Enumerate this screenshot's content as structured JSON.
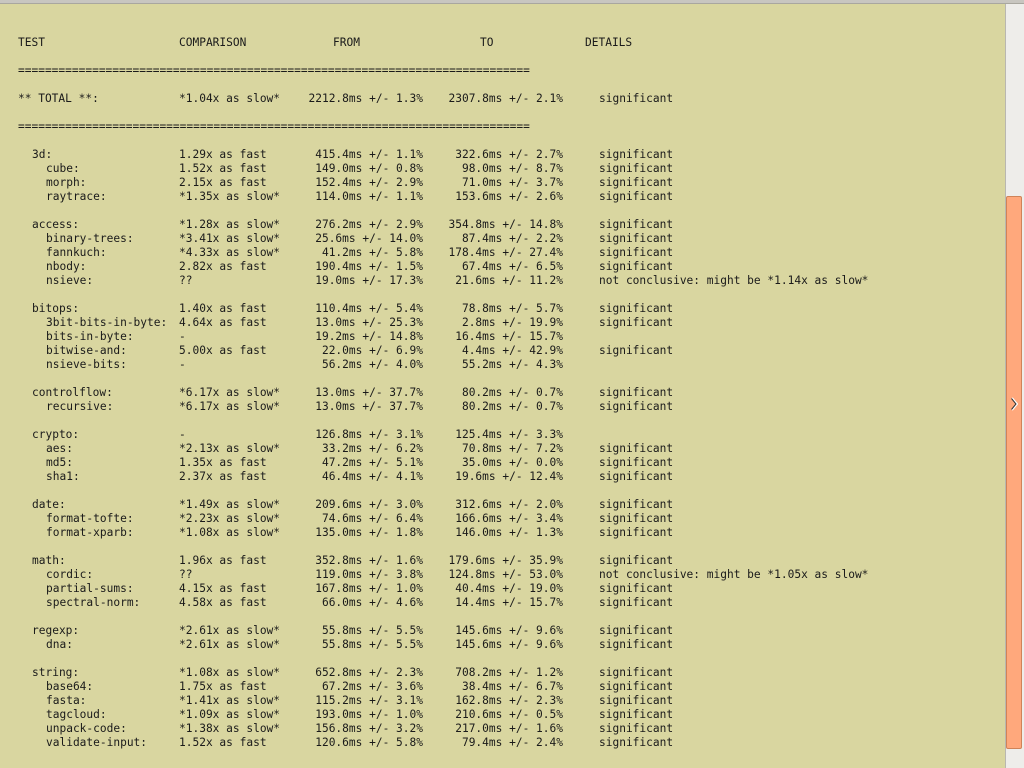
{
  "header": {
    "test": "TEST",
    "comparison": "COMPARISON",
    "from": "FROM",
    "to": "TO",
    "details": "DETAILS"
  },
  "separator": "============================================================================",
  "total": {
    "name": "** TOTAL **:",
    "comparison": "*1.04x as slow*",
    "from": "2212.8ms +/- 1.3%",
    "to": "2307.8ms +/- 2.1%",
    "details": "significant"
  },
  "groups": [
    {
      "row": {
        "name": "3d:",
        "comparison": "1.29x as fast",
        "from": "415.4ms +/- 1.1%",
        "to": "322.6ms +/- 2.7%",
        "details": "significant"
      },
      "items": [
        {
          "name": "cube:",
          "comparison": "1.52x as fast",
          "from": "149.0ms +/- 0.8%",
          "to": "98.0ms +/- 8.7%",
          "details": "significant"
        },
        {
          "name": "morph:",
          "comparison": "2.15x as fast",
          "from": "152.4ms +/- 2.9%",
          "to": "71.0ms +/- 3.7%",
          "details": "significant"
        },
        {
          "name": "raytrace:",
          "comparison": "*1.35x as slow*",
          "from": "114.0ms +/- 1.1%",
          "to": "153.6ms +/- 2.6%",
          "details": "significant"
        }
      ]
    },
    {
      "row": {
        "name": "access:",
        "comparison": "*1.28x as slow*",
        "from": "276.2ms +/- 2.9%",
        "to": "354.8ms +/- 14.8%",
        "details": "significant"
      },
      "items": [
        {
          "name": "binary-trees:",
          "comparison": "*3.41x as slow*",
          "from": "25.6ms +/- 14.0%",
          "to": "87.4ms +/- 2.2%",
          "details": "significant"
        },
        {
          "name": "fannkuch:",
          "comparison": "*4.33x as slow*",
          "from": "41.2ms +/- 5.8%",
          "to": "178.4ms +/- 27.4%",
          "details": "significant"
        },
        {
          "name": "nbody:",
          "comparison": "2.82x as fast",
          "from": "190.4ms +/- 1.5%",
          "to": "67.4ms +/- 6.5%",
          "details": "significant"
        },
        {
          "name": "nsieve:",
          "comparison": "??",
          "from": "19.0ms +/- 17.3%",
          "to": "21.6ms +/- 11.2%",
          "details": "not conclusive: might be *1.14x as slow*"
        }
      ]
    },
    {
      "row": {
        "name": "bitops:",
        "comparison": "1.40x as fast",
        "from": "110.4ms +/- 5.4%",
        "to": "78.8ms +/- 5.7%",
        "details": "significant"
      },
      "items": [
        {
          "name": "3bit-bits-in-byte:",
          "comparison": "4.64x as fast",
          "from": "13.0ms +/- 25.3%",
          "to": "2.8ms +/- 19.9%",
          "details": "significant"
        },
        {
          "name": "bits-in-byte:",
          "comparison": "-",
          "from": "19.2ms +/- 14.8%",
          "to": "16.4ms +/- 15.7%",
          "details": ""
        },
        {
          "name": "bitwise-and:",
          "comparison": "5.00x as fast",
          "from": "22.0ms +/- 6.9%",
          "to": "4.4ms +/- 42.9%",
          "details": "significant"
        },
        {
          "name": "nsieve-bits:",
          "comparison": "-",
          "from": "56.2ms +/- 4.0%",
          "to": "55.2ms +/- 4.3%",
          "details": ""
        }
      ]
    },
    {
      "row": {
        "name": "controlflow:",
        "comparison": "*6.17x as slow*",
        "from": "13.0ms +/- 37.7%",
        "to": "80.2ms +/- 0.7%",
        "details": "significant"
      },
      "items": [
        {
          "name": "recursive:",
          "comparison": "*6.17x as slow*",
          "from": "13.0ms +/- 37.7%",
          "to": "80.2ms +/- 0.7%",
          "details": "significant"
        }
      ]
    },
    {
      "row": {
        "name": "crypto:",
        "comparison": "-",
        "from": "126.8ms +/- 3.1%",
        "to": "125.4ms +/- 3.3%",
        "details": ""
      },
      "items": [
        {
          "name": "aes:",
          "comparison": "*2.13x as slow*",
          "from": "33.2ms +/- 6.2%",
          "to": "70.8ms +/- 7.2%",
          "details": "significant"
        },
        {
          "name": "md5:",
          "comparison": "1.35x as fast",
          "from": "47.2ms +/- 5.1%",
          "to": "35.0ms +/- 0.0%",
          "details": "significant"
        },
        {
          "name": "sha1:",
          "comparison": "2.37x as fast",
          "from": "46.4ms +/- 4.1%",
          "to": "19.6ms +/- 12.4%",
          "details": "significant"
        }
      ]
    },
    {
      "row": {
        "name": "date:",
        "comparison": "*1.49x as slow*",
        "from": "209.6ms +/- 3.0%",
        "to": "312.6ms +/- 2.0%",
        "details": "significant"
      },
      "items": [
        {
          "name": "format-tofte:",
          "comparison": "*2.23x as slow*",
          "from": "74.6ms +/- 6.4%",
          "to": "166.6ms +/- 3.4%",
          "details": "significant"
        },
        {
          "name": "format-xparb:",
          "comparison": "*1.08x as slow*",
          "from": "135.0ms +/- 1.8%",
          "to": "146.0ms +/- 1.3%",
          "details": "significant"
        }
      ]
    },
    {
      "row": {
        "name": "math:",
        "comparison": "1.96x as fast",
        "from": "352.8ms +/- 1.6%",
        "to": "179.6ms +/- 35.9%",
        "details": "significant"
      },
      "items": [
        {
          "name": "cordic:",
          "comparison": "??",
          "from": "119.0ms +/- 3.8%",
          "to": "124.8ms +/- 53.0%",
          "details": "not conclusive: might be *1.05x as slow*"
        },
        {
          "name": "partial-sums:",
          "comparison": "4.15x as fast",
          "from": "167.8ms +/- 1.0%",
          "to": "40.4ms +/- 19.0%",
          "details": "significant"
        },
        {
          "name": "spectral-norm:",
          "comparison": "4.58x as fast",
          "from": "66.0ms +/- 4.6%",
          "to": "14.4ms +/- 15.7%",
          "details": "significant"
        }
      ]
    },
    {
      "row": {
        "name": "regexp:",
        "comparison": "*2.61x as slow*",
        "from": "55.8ms +/- 5.5%",
        "to": "145.6ms +/- 9.6%",
        "details": "significant"
      },
      "items": [
        {
          "name": "dna:",
          "comparison": "*2.61x as slow*",
          "from": "55.8ms +/- 5.5%",
          "to": "145.6ms +/- 9.6%",
          "details": "significant"
        }
      ]
    },
    {
      "row": {
        "name": "string:",
        "comparison": "*1.08x as slow*",
        "from": "652.8ms +/- 2.3%",
        "to": "708.2ms +/- 1.2%",
        "details": "significant"
      },
      "items": [
        {
          "name": "base64:",
          "comparison": "1.75x as fast",
          "from": "67.2ms +/- 3.6%",
          "to": "38.4ms +/- 6.7%",
          "details": "significant"
        },
        {
          "name": "fasta:",
          "comparison": "*1.41x as slow*",
          "from": "115.2ms +/- 3.1%",
          "to": "162.8ms +/- 2.3%",
          "details": "significant"
        },
        {
          "name": "tagcloud:",
          "comparison": "*1.09x as slow*",
          "from": "193.0ms +/- 1.0%",
          "to": "210.6ms +/- 0.5%",
          "details": "significant"
        },
        {
          "name": "unpack-code:",
          "comparison": "*1.38x as slow*",
          "from": "156.8ms +/- 3.2%",
          "to": "217.0ms +/- 1.6%",
          "details": "significant"
        },
        {
          "name": "validate-input:",
          "comparison": "1.52x as fast",
          "from": "120.6ms +/- 5.8%",
          "to": "79.4ms +/- 2.4%",
          "details": "significant"
        }
      ]
    }
  ]
}
